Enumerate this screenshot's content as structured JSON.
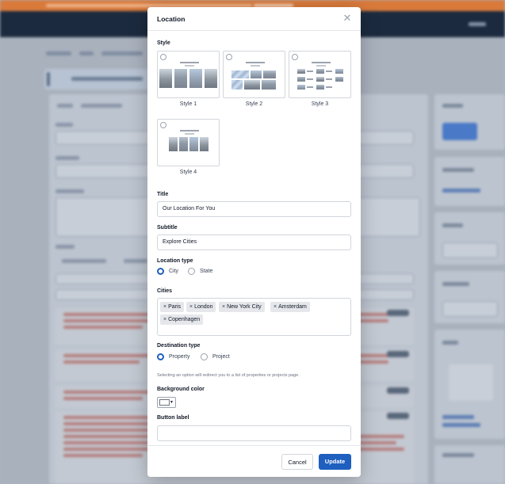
{
  "modal": {
    "title": "Location",
    "close_icon": "close-icon"
  },
  "style": {
    "label": "Style",
    "options": [
      {
        "label": "Style 1",
        "selected": false
      },
      {
        "label": "Style 2",
        "selected": false
      },
      {
        "label": "Style 3",
        "selected": false
      },
      {
        "label": "Style 4",
        "selected": false
      }
    ]
  },
  "title_field": {
    "label": "Title",
    "value": "Our Location For You"
  },
  "subtitle_field": {
    "label": "Subtitle",
    "value": "Explore Cities"
  },
  "location_type": {
    "label": "Location type",
    "options": [
      {
        "label": "City",
        "selected": true
      },
      {
        "label": "State",
        "selected": false
      }
    ]
  },
  "cities": {
    "label": "Cities",
    "tags": [
      "Paris",
      "London",
      "New York City",
      "Amsterdam",
      "Copenhagen"
    ],
    "remove_glyph": "×"
  },
  "destination_type": {
    "label": "Destination type",
    "options": [
      {
        "label": "Property",
        "selected": true
      },
      {
        "label": "Project",
        "selected": false
      }
    ],
    "helper": "Selecting an option will redirect you to a list of properties or projects page."
  },
  "background_color": {
    "label": "Background color",
    "value": "#ffffff"
  },
  "button_label": {
    "label": "Button label",
    "value": ""
  },
  "footer": {
    "cancel_label": "Cancel",
    "update_label": "Update"
  },
  "colors": {
    "accent": "#1e5fbf",
    "banner": "#d97a3b",
    "nav": "#1c2a3f"
  }
}
